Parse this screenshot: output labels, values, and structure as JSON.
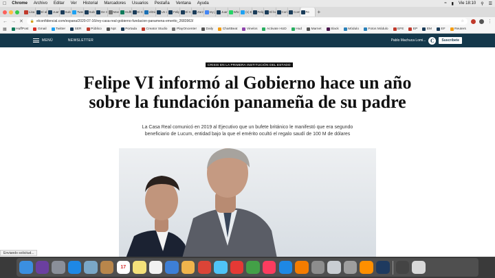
{
  "menubar": {
    "apple": "",
    "items": [
      "Chrome",
      "Archivo",
      "Editar",
      "Ver",
      "Historial",
      "Marcadores",
      "Usuarios",
      "Pestaña",
      "Ventana",
      "Ayuda"
    ],
    "clock": "Vie 18:10"
  },
  "tabs": [
    {
      "label": "Lisa",
      "color": "#c0392b"
    },
    {
      "label": "El alc",
      "color": "#1a3c59"
    },
    {
      "label": "Juan",
      "color": "#1a3c59"
    },
    {
      "label": "Subsi",
      "color": "#1a3c59"
    },
    {
      "label": "Twee",
      "color": "#1da1f2"
    },
    {
      "label": "Subsi",
      "color": "#1a3c59"
    },
    {
      "label": "De Si",
      "color": "#1a3c59"
    },
    {
      "label": "Marc",
      "color": "#777777"
    },
    {
      "label": "HuffP",
      "color": "#0e7a5a"
    },
    {
      "label": "El Co",
      "color": "#1a3c59"
    },
    {
      "label": "elDia",
      "color": "#1a6fb3"
    },
    {
      "label": "Un ci",
      "color": "#1a3c59"
    },
    {
      "label": "Felip",
      "color": "#1a3c59"
    },
    {
      "label": "El Co",
      "color": "#1a3c59"
    },
    {
      "label": "Zarzu",
      "color": "#1a3c59"
    },
    {
      "label": "rey ju",
      "color": "#4285f4"
    },
    {
      "label": "Juan",
      "color": "#1a3c59"
    },
    {
      "label": "Whats",
      "color": "#25d366"
    },
    {
      "label": "(1) El",
      "color": "#1da1f2"
    },
    {
      "label": "Felip",
      "color": "#1a3c59"
    },
    {
      "label": "El bu",
      "color": "#1a3c59"
    },
    {
      "label": "Corin",
      "color": "#1a3c59"
    },
    {
      "label": "Conv",
      "color": "#1a3c59"
    },
    {
      "label": "Fe",
      "color": "#1a3c59",
      "active": true
    }
  ],
  "address": {
    "url": "elconfidencial.com/espana/2020-07-16/rey-casa-real-gobierno-fundacion-panamena-emerito_2683963/"
  },
  "bookmarks": [
    {
      "label": "HuffPost",
      "color": "#0e7a5a"
    },
    {
      "label": "Gmail",
      "color": "#d93025"
    },
    {
      "label": "Twitter",
      "color": "#1da1f2"
    },
    {
      "label": "SER",
      "color": "#1a3c59"
    },
    {
      "label": "Público",
      "color": "#c0392b"
    },
    {
      "label": "Npt",
      "color": "#555555"
    },
    {
      "label": "Portada",
      "color": "#1a3c59"
    },
    {
      "label": "Creator Studio",
      "color": "#c0392b"
    },
    {
      "label": "PlayOncenter",
      "color": "#777777"
    },
    {
      "label": "Daily",
      "color": "#555555"
    },
    {
      "label": "ChartBeat",
      "color": "#f39c12"
    },
    {
      "label": "Vinelos",
      "color": "#8e44ad"
    },
    {
      "label": "Activate HUD",
      "color": "#27ae60"
    },
    {
      "label": "Hud",
      "color": "#27ae60"
    },
    {
      "label": "Marnet",
      "color": "#555555"
    },
    {
      "label": "Slack",
      "color": "#4a154b"
    },
    {
      "label": "Módulo",
      "color": "#2980b9"
    },
    {
      "label": "Fotos Módulo",
      "color": "#2980b9"
    },
    {
      "label": "EFE",
      "color": "#c0392b"
    },
    {
      "label": "EP",
      "color": "#c0392b"
    },
    {
      "label": "EM",
      "color": "#1a3c59"
    },
    {
      "label": "EF",
      "color": "#1a3c59"
    },
    {
      "label": "Reuters",
      "color": "#f39c12"
    }
  ],
  "site": {
    "menu_label": "MENÚ",
    "newsletter_label": "NEWSLETTER",
    "user_name": "Pablo Machuca Lomi...",
    "logo_letter": "C",
    "subscribe_label": "Suscríbete",
    "brand_color": "#14384b"
  },
  "article": {
    "kicker": "CRISIS EN LA PRIMERA INSTITUCIÓN DEL ESTADO",
    "headline": "Felipe VI informó al Gobierno hace un año sobre la fundación panameña de su padre",
    "subhead": "La Casa Real comunicó en 2019 al Ejecutivo que un bufete británico le manifestó que era segundo beneficiario de Lucum, entidad bajo la que el emérito ocultó el regalo saudí de 100 M de dólares"
  },
  "status": {
    "text": "Enviando solicitud..."
  },
  "dock": [
    {
      "name": "finder",
      "color": "#3b8fe0"
    },
    {
      "name": "siri",
      "color": "#6b3fa0"
    },
    {
      "name": "launchpad",
      "color": "#8a8f99"
    },
    {
      "name": "safari",
      "color": "#1e88e5"
    },
    {
      "name": "preview",
      "color": "#7aa7c7"
    },
    {
      "name": "contacts",
      "color": "#b8864b"
    },
    {
      "name": "calendar",
      "color": "#ffffff",
      "label": "17"
    },
    {
      "name": "notes",
      "color": "#f5e27a"
    },
    {
      "name": "reminders",
      "color": "#f2f2f2"
    },
    {
      "name": "keynote",
      "color": "#3d7fd6"
    },
    {
      "name": "photos",
      "color": "#f0b44c"
    },
    {
      "name": "chrome",
      "color": "#db4437"
    },
    {
      "name": "messages-bubble",
      "color": "#4fc3f7"
    },
    {
      "name": "opera",
      "color": "#e53935"
    },
    {
      "name": "facetime",
      "color": "#43a047"
    },
    {
      "name": "music",
      "color": "#fc3c5f"
    },
    {
      "name": "app-store",
      "color": "#1e88e5"
    },
    {
      "name": "books",
      "color": "#f57c00"
    },
    {
      "name": "system-preferences",
      "color": "#8d8d8d"
    },
    {
      "name": "chrome-canary",
      "color": "#c9cdd2"
    },
    {
      "name": "calculator",
      "color": "#9e9e9e"
    },
    {
      "name": "vlc",
      "color": "#ff8f00"
    },
    {
      "name": "quicktime",
      "color": "#1e3a5f"
    },
    {
      "name": "sep",
      "color": ""
    },
    {
      "name": "screenshot",
      "color": "#444444"
    },
    {
      "name": "trash",
      "color": "#d9d9d9"
    }
  ],
  "colors": {
    "menubar": "#e9e9e9",
    "tabstrip": "#dcdcdc",
    "toolbar": "#f6f6f6",
    "dock": "#3a3a3a"
  }
}
